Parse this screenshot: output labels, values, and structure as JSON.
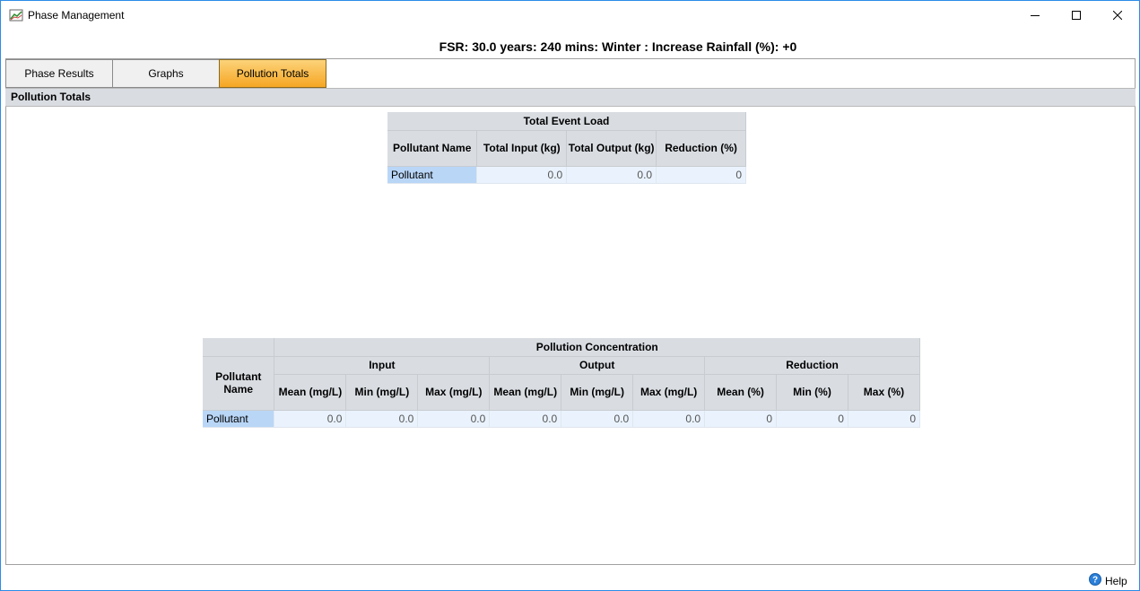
{
  "window": {
    "title": "Phase Management",
    "header": "FSR: 30.0 years: 240 mins: Winter : Increase Rainfall (%): +0"
  },
  "tabs": [
    {
      "label": "Phase Results"
    },
    {
      "label": "Graphs"
    },
    {
      "label": "Pollution Totals",
      "active": true
    }
  ],
  "section": {
    "title": "Pollution Totals"
  },
  "event_load": {
    "title": "Total Event Load",
    "columns": [
      "Pollutant Name",
      "Total Input (kg)",
      "Total Output (kg)",
      "Reduction (%)"
    ],
    "rows": [
      {
        "name": "Pollutant",
        "input": "0.0",
        "output": "0.0",
        "reduction": "0"
      }
    ]
  },
  "concentration": {
    "title": "Pollution Concentration",
    "name_header": "Pollutant Name",
    "groups": [
      "Input",
      "Output",
      "Reduction"
    ],
    "columns": [
      "Mean (mg/L)",
      "Min (mg/L)",
      "Max (mg/L)",
      "Mean (mg/L)",
      "Min (mg/L)",
      "Max (mg/L)",
      "Mean (%)",
      "Min (%)",
      "Max (%)"
    ],
    "rows": [
      {
        "name": "Pollutant",
        "values": [
          "0.0",
          "0.0",
          "0.0",
          "0.0",
          "0.0",
          "0.0",
          "0",
          "0",
          "0"
        ]
      }
    ]
  },
  "footer": {
    "help_label": "Help"
  },
  "icons": {
    "app": "chart-icon",
    "help": "help-icon"
  },
  "colors": {
    "active_tab": "#f6a623",
    "header_bg": "#d9dde2",
    "name_cell": "#b9d6f7",
    "value_cell": "#eaf3fd",
    "window_border": "#2b8ce8"
  }
}
